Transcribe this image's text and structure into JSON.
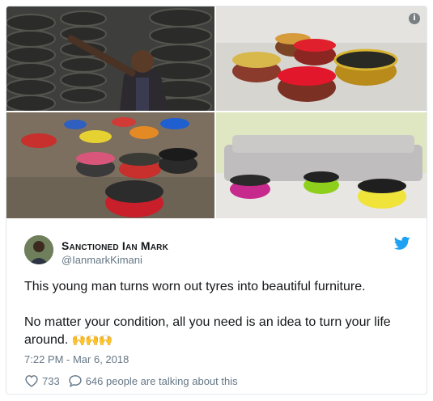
{
  "tweet": {
    "author_name": "Sanctioned Ian Mark",
    "author_handle": "@IanmarkKimani",
    "text_line1": "This young man turns worn out tyres into beautiful furniture.",
    "text_line2": "No matter your condition, all you need is an idea to turn your life around.",
    "emoji": "🙌🙌🙌",
    "timestamp": "7:22 PM - Mar 6, 2018",
    "likes": "733",
    "conversation": "646 people are talking about this"
  },
  "icons": {
    "info": "i",
    "brand": "twitter-bird-icon",
    "like": "heart-icon",
    "reply": "speech-bubble-icon"
  },
  "colors": {
    "brand": "#1da1f2",
    "muted": "#657786",
    "text": "#14171a"
  }
}
